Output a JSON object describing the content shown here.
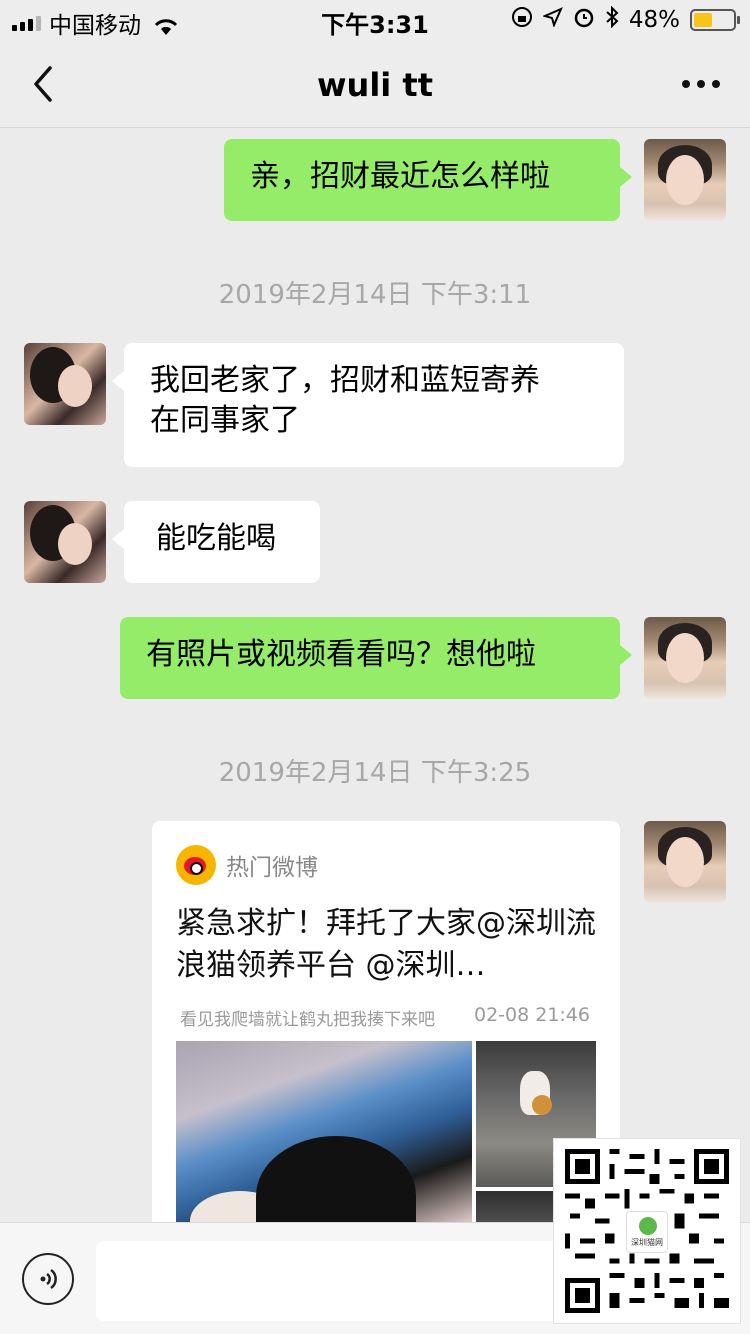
{
  "status_bar": {
    "carrier": "中国移动",
    "time": "下午3:31",
    "battery": "48%",
    "battery_level": 0.48
  },
  "header": {
    "title": "wuli tt",
    "back_icon": "chevron-left-icon",
    "more_icon": "more-dots-icon"
  },
  "messages": {
    "m1": "亲，招财最近怎么样啦",
    "t1": "2019年2月14日 下午3:11",
    "m2_line1": "我回老家了，招财和蓝短寄养",
    "m2_line2": "在同事家了",
    "m3": "能吃能喝",
    "m4": "有照片或视频看看吗？想他啦",
    "t2": "2019年2月14日 下午3:25"
  },
  "shared_card": {
    "source": "热门微博",
    "title": "紧急求扩！拜托了大家@深圳流浪猫领养平台 @深圳…",
    "caption": "看见我爬墙就让鹤丸把我揍下来吧",
    "date": "02-08 21:46"
  },
  "qr": {
    "badge": "深圳猫网"
  },
  "input": {
    "placeholder": ""
  },
  "colors": {
    "my_bubble": "#95ec69",
    "their_bubble": "#ffffff",
    "background": "#ebebeb"
  }
}
